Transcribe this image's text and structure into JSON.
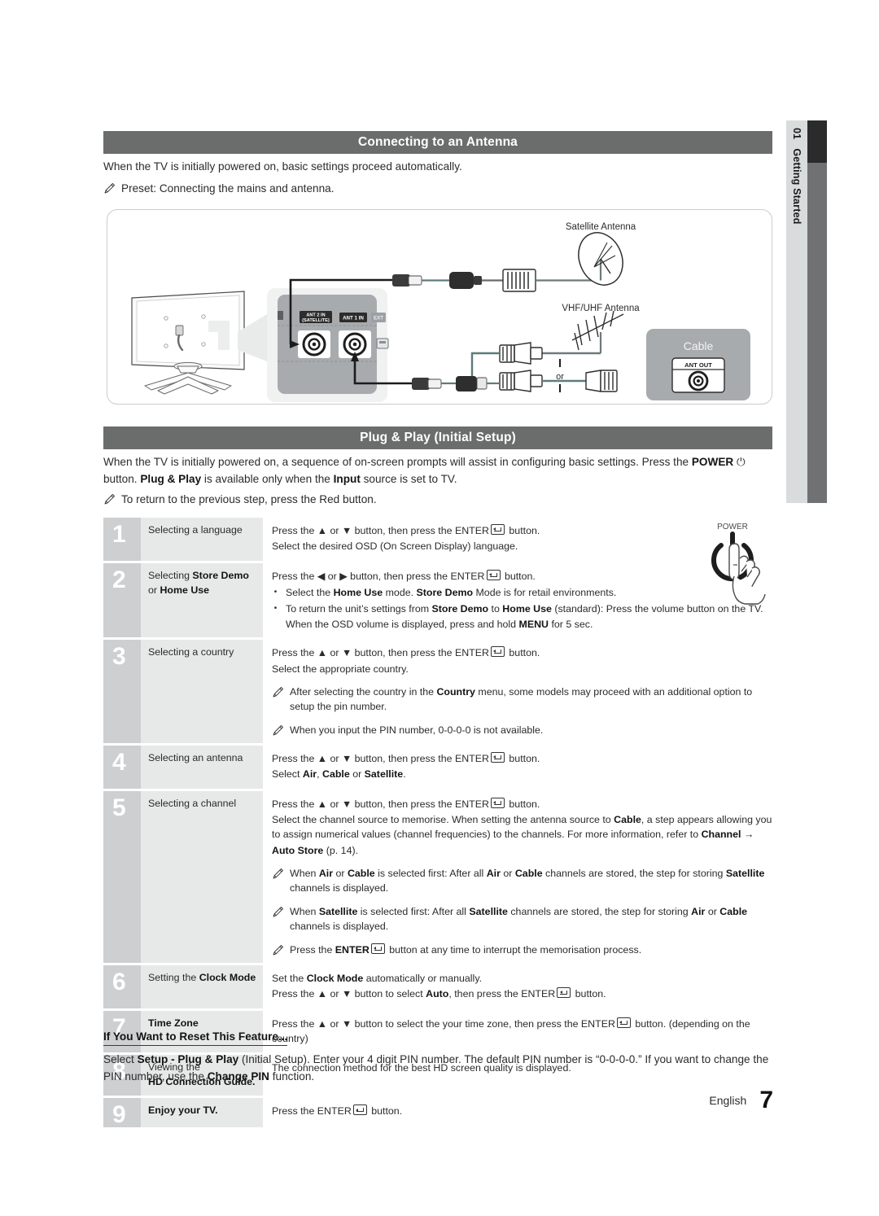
{
  "side_tab": {
    "chapter_number": "01",
    "chapter_title": "Getting Started"
  },
  "sections": {
    "antenna": {
      "heading": "Connecting to an Antenna",
      "intro": "When the TV is initially powered on, basic settings proceed automatically.",
      "note": "Preset: Connecting the mains and antenna.",
      "diagram": {
        "satellite_antenna_label": "Satellite Antenna",
        "vhf_uhf_antenna_label": "VHF/UHF Antenna",
        "or_label": "or",
        "cable_box_label": "Cable",
        "cable_box_port": "ANT OUT",
        "tv_ports": {
          "ant2": "ANT 2 IN",
          "ant2_sub": "(SATELLITE)",
          "ant1": "ANT 1 IN",
          "ext": "EXT"
        }
      }
    },
    "plug_and_play": {
      "heading": "Plug & Play (Initial Setup)",
      "intro_parts": [
        {
          "t": "When the TV is initially powered on, a sequence of on-screen prompts will assist in configuring basic settings. Press the ",
          "b": false
        },
        {
          "t": "POWER",
          "b": true
        },
        {
          "t": " ⏻ button. ",
          "b": false
        },
        {
          "t": "Plug & Play",
          "b": true
        },
        {
          "t": " is available only when the ",
          "b": false
        },
        {
          "t": "Input",
          "b": true
        },
        {
          "t": " source is set to TV.",
          "b": false
        }
      ],
      "note": "To return to the previous step, press the Red button.",
      "power_illustration_label": "POWER"
    }
  },
  "steps": [
    {
      "number": "1",
      "label_parts": [
        {
          "t": "Selecting a language",
          "b": false
        }
      ],
      "lines": [
        [
          {
            "t": "Press the ▲ or ▼ button, then press the ",
            "b": false
          },
          {
            "t": "ENTER",
            "b": false,
            "enter": true
          },
          {
            "t": " button.",
            "b": false
          }
        ],
        [
          {
            "t": "Select the desired OSD (On Screen Display) language.",
            "b": false
          }
        ]
      ],
      "bullets": [],
      "notes": []
    },
    {
      "number": "2",
      "label_parts": [
        {
          "t": "Selecting ",
          "b": false
        },
        {
          "t": "Store Demo",
          "b": true
        },
        {
          "t": " or ",
          "b": false
        },
        {
          "t": "Home Use",
          "b": true
        }
      ],
      "lines": [
        [
          {
            "t": "Press the ◀ or ▶ button, then press the ",
            "b": false
          },
          {
            "t": "ENTER",
            "b": false,
            "enter": true
          },
          {
            "t": " button.",
            "b": false
          }
        ]
      ],
      "bullets": [
        [
          {
            "t": "Select the ",
            "b": false
          },
          {
            "t": "Home Use",
            "b": true
          },
          {
            "t": " mode. ",
            "b": false
          },
          {
            "t": "Store Demo",
            "b": true
          },
          {
            "t": " Mode is for retail environments.",
            "b": false
          }
        ],
        [
          {
            "t": "To return the unit’s settings from ",
            "b": false
          },
          {
            "t": "Store Demo",
            "b": true
          },
          {
            "t": " to ",
            "b": false
          },
          {
            "t": "Home Use",
            "b": true
          },
          {
            "t": " (standard): Press the volume button on the TV. When the OSD volume is displayed, press and hold ",
            "b": false
          },
          {
            "t": "MENU",
            "b": true
          },
          {
            "t": " for 5 sec.",
            "b": false
          }
        ]
      ],
      "notes": []
    },
    {
      "number": "3",
      "label_parts": [
        {
          "t": "Selecting a country",
          "b": false
        }
      ],
      "lines": [
        [
          {
            "t": "Press the ▲ or ▼ button, then press the ",
            "b": false
          },
          {
            "t": "ENTER",
            "b": false,
            "enter": true
          },
          {
            "t": " button.",
            "b": false
          }
        ],
        [
          {
            "t": "Select the appropriate country.",
            "b": false
          }
        ]
      ],
      "bullets": [],
      "notes": [
        [
          {
            "t": "After selecting the country in the ",
            "b": false
          },
          {
            "t": "Country",
            "b": true
          },
          {
            "t": " menu, some models may proceed with an additional option to setup the pin number.",
            "b": false
          }
        ],
        [
          {
            "t": "When you input the PIN number, 0-0-0-0 is not available.",
            "b": false
          }
        ]
      ]
    },
    {
      "number": "4",
      "label_parts": [
        {
          "t": "Selecting an antenna",
          "b": false
        }
      ],
      "lines": [
        [
          {
            "t": "Press the ▲ or ▼ button, then press the ",
            "b": false
          },
          {
            "t": "ENTER",
            "b": false,
            "enter": true
          },
          {
            "t": " button.",
            "b": false
          }
        ],
        [
          {
            "t": "Select ",
            "b": false
          },
          {
            "t": "Air",
            "b": true
          },
          {
            "t": ", ",
            "b": false
          },
          {
            "t": "Cable",
            "b": true
          },
          {
            "t": " or ",
            "b": false
          },
          {
            "t": "Satellite",
            "b": true
          },
          {
            "t": ".",
            "b": false
          }
        ]
      ],
      "bullets": [],
      "notes": []
    },
    {
      "number": "5",
      "label_parts": [
        {
          "t": "Selecting a channel",
          "b": false
        }
      ],
      "lines": [
        [
          {
            "t": "Press the ▲ or ▼ button, then press the ",
            "b": false
          },
          {
            "t": "ENTER",
            "b": false,
            "enter": true
          },
          {
            "t": " button.",
            "b": false
          }
        ],
        [
          {
            "t": "Select the channel source to memorise. When setting the antenna source to ",
            "b": false
          },
          {
            "t": "Cable",
            "b": true
          },
          {
            "t": ", a step appears allowing you to assign numerical values (channel frequencies) to the channels. For more information, refer to ",
            "b": false
          },
          {
            "t": "Channel →",
            "b": true
          }
        ],
        [
          {
            "t": "Auto Store",
            "b": true
          },
          {
            "t": " (p. 14).",
            "b": false
          }
        ]
      ],
      "bullets": [],
      "notes": [
        [
          {
            "t": "When ",
            "b": false
          },
          {
            "t": "Air",
            "b": true
          },
          {
            "t": " or ",
            "b": false
          },
          {
            "t": "Cable",
            "b": true
          },
          {
            "t": " is selected first: After all ",
            "b": false
          },
          {
            "t": "Air",
            "b": true
          },
          {
            "t": " or ",
            "b": false
          },
          {
            "t": "Cable",
            "b": true
          },
          {
            "t": " channels are stored, the step for storing ",
            "b": false
          },
          {
            "t": "Satellite",
            "b": true
          },
          {
            "t": " channels is displayed.",
            "b": false
          }
        ],
        [
          {
            "t": "When ",
            "b": false
          },
          {
            "t": "Satellite",
            "b": true
          },
          {
            "t": " is selected first: After all ",
            "b": false
          },
          {
            "t": "Satellite",
            "b": true
          },
          {
            "t": " channels are stored, the step for storing ",
            "b": false
          },
          {
            "t": "Air",
            "b": true
          },
          {
            "t": " or ",
            "b": false
          },
          {
            "t": "Cable",
            "b": true
          },
          {
            "t": " channels is displayed.",
            "b": false
          }
        ],
        [
          {
            "t": "Press the ",
            "b": false
          },
          {
            "t": "ENTER",
            "b": true,
            "enter": true
          },
          {
            "t": " button at any time to interrupt the memorisation process.",
            "b": false
          }
        ]
      ]
    },
    {
      "number": "6",
      "label_parts": [
        {
          "t": "Setting the ",
          "b": false
        },
        {
          "t": "Clock Mode",
          "b": true
        }
      ],
      "lines": [
        [
          {
            "t": "Set the ",
            "b": false
          },
          {
            "t": "Clock Mode",
            "b": true
          },
          {
            "t": " automatically or manually.",
            "b": false
          }
        ],
        [
          {
            "t": "Press the ▲ or ▼ button to select ",
            "b": false
          },
          {
            "t": "Auto",
            "b": true
          },
          {
            "t": ", then press the ",
            "b": false
          },
          {
            "t": "ENTER",
            "b": false,
            "enter": true
          },
          {
            "t": " button.",
            "b": false
          }
        ]
      ],
      "bullets": [],
      "notes": []
    },
    {
      "number": "7",
      "label_parts": [
        {
          "t": "Time Zone",
          "b": true
        }
      ],
      "lines": [
        [
          {
            "t": "Press the ▲ or ▼ button to select the your time zone, then press the ",
            "b": false
          },
          {
            "t": "ENTER",
            "b": false,
            "enter": true
          },
          {
            "t": " button. (depending on the country)",
            "b": false
          }
        ]
      ],
      "bullets": [],
      "notes": []
    },
    {
      "number": "8",
      "label_parts": [
        {
          "t": "Viewing the",
          "b": false
        },
        {
          "t": "\n",
          "b": false
        },
        {
          "t": "HD Connection Guide.",
          "b": true
        }
      ],
      "lines": [
        [
          {
            "t": "The connection method for the best HD screen quality is displayed.",
            "b": false
          }
        ]
      ],
      "bullets": [],
      "notes": []
    },
    {
      "number": "9",
      "label_parts": [
        {
          "t": "Enjoy your TV.",
          "b": true
        }
      ],
      "lines": [
        [
          {
            "t": "Press the ",
            "b": false
          },
          {
            "t": "ENTER",
            "b": false,
            "enter": true
          },
          {
            "t": " button.",
            "b": false
          }
        ]
      ],
      "bullets": [],
      "notes": []
    }
  ],
  "reset_feature": {
    "title": "If You Want to Reset This Feature...",
    "body_parts": [
      {
        "t": "Select ",
        "b": false
      },
      {
        "t": "Setup - Plug & Play",
        "b": true
      },
      {
        "t": " (Initial Setup). Enter your 4 digit PIN number. The default PIN number is “0-0-0-0.” If you want to change the PIN number, use the ",
        "b": false
      },
      {
        "t": "Change PIN",
        "b": true
      },
      {
        "t": " function.",
        "b": false
      }
    ]
  },
  "footer": {
    "language": "English",
    "page_number": "7"
  },
  "colors": {
    "header_bar": "#6b6d6d",
    "step_number_bg": "#cdcfd0",
    "step_label_bg": "#e7e8e8",
    "side_tab_bg": "#d9dcdd",
    "side_tab_dark": "#2b2b2b",
    "text": "#2b2b2b"
  }
}
